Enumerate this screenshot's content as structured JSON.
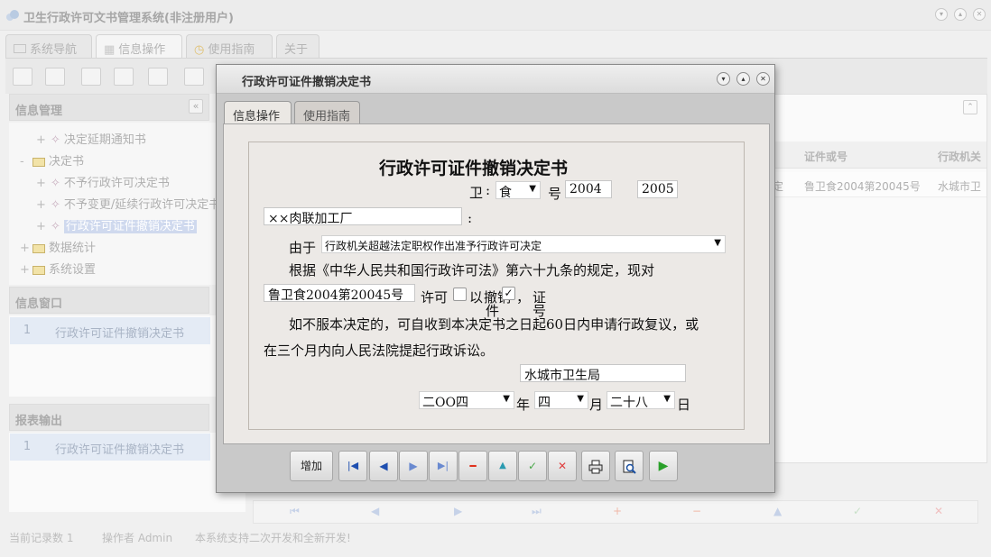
{
  "app": {
    "title": "卫生行政许可文书管理系统(非注册用户)"
  },
  "main_tabs": [
    {
      "label": "系统导航",
      "icon": "monitor-icon"
    },
    {
      "label": "信息操作",
      "icon": "grid-icon"
    },
    {
      "label": "使用指南",
      "icon": "clock-icon"
    },
    {
      "label": "关于",
      "icon": ""
    }
  ],
  "sidebar": {
    "info_management": {
      "title": "信息管理",
      "collapse_glyph": "«",
      "items": [
        {
          "label": "决定延期通知书",
          "level": 1,
          "type": "doc"
        },
        {
          "label": "决定书",
          "level": 0,
          "type": "folder",
          "expander": "-"
        },
        {
          "label": "不予行政许可决定书",
          "level": 1,
          "type": "doc"
        },
        {
          "label": "不予变更/延续行政许可决定书",
          "level": 1,
          "type": "doc"
        },
        {
          "label": "行政许可证件撤销决定书",
          "level": 1,
          "type": "doc",
          "selected": true
        },
        {
          "label": "数据统计",
          "level": 0,
          "type": "folder",
          "expander": "+"
        },
        {
          "label": "系统设置",
          "level": 0,
          "type": "folder",
          "expander": "+"
        }
      ]
    },
    "info_window": {
      "title": "信息窗口",
      "rows": [
        {
          "num": "1",
          "label": "行政许可证件撤销决定书"
        }
      ]
    },
    "report_output": {
      "title": "报表输出",
      "rows": [
        {
          "num": "1",
          "label": "行政许可证件撤销决定书"
        }
      ]
    }
  },
  "grid": {
    "columns": [
      "证件或号",
      "行政机关"
    ],
    "row": {
      "partial": "定",
      "cert": "鲁卫食2004第20045号",
      "org": "水城市卫"
    }
  },
  "bottom_nav": {
    "add": "+",
    "delete": "−",
    "up": "▲",
    "ok": "✓",
    "cancel": "✕"
  },
  "statusbar": {
    "record_count": "当前记录数 1",
    "operator": "操作者 Admin",
    "note": "本系统支持二次开发和全新开发!"
  },
  "dialog": {
    "title": "行政许可证件撤销决定书",
    "tabs": [
      "信息操作",
      "使用指南"
    ],
    "form": {
      "heading": "行政许可证件撤销决定书",
      "wei_label": "卫",
      "wei_colon": ":",
      "category_select": "食",
      "hao_label": "号",
      "year_input": "2004",
      "number_input": "2005",
      "party_input": "××肉联加工厂",
      "party_colon": ":",
      "reason_label": "由于",
      "reason_select": "行政机关超越法定职权作出准予行政许可决定",
      "basis_text": "根据《中华人民共和国行政许可法》第六十九条的规定，现对",
      "cert_input": "鲁卫食2004第20045号",
      "license_text": "许可",
      "yi_text": "以",
      "revoke_label": "撤销",
      "revoke_under": "件",
      "comma": "，",
      "cert_label": "证",
      "cert_under": "号",
      "appeal_line1": "如不服本决定的，可自收到本决定书之日起60日内申请行政复议，或",
      "appeal_line2": "在三个月内向人民法院提起行政诉讼。",
      "authority_input": "水城市卫生局",
      "date_year_select": "二OO四",
      "year_label": "年",
      "date_month_select": "四",
      "month_label": "月",
      "date_day_select": "二十八",
      "day_label": "日"
    },
    "buttons": {
      "add_label": "增加"
    }
  }
}
